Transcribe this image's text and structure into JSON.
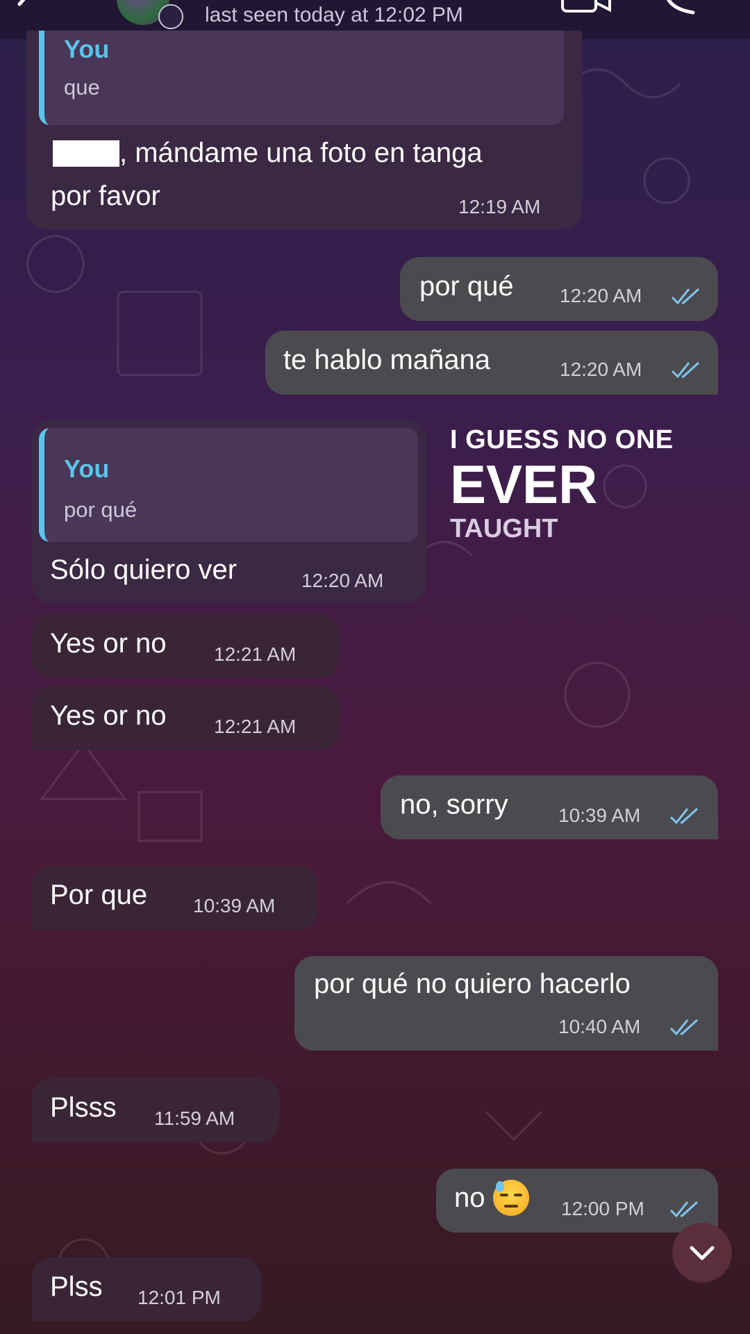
{
  "header": {
    "last_seen": "last seen today at 12:02 PM"
  },
  "messages": [
    {
      "reply_name": "You",
      "reply_text": "que",
      "text_line1": ", mándame una foto en tanga",
      "text_line2": "por favor",
      "time": "12:19 AM"
    },
    {
      "text": "por qué",
      "time": "12:20 AM"
    },
    {
      "text": "te hablo mañana",
      "time": "12:20 AM"
    },
    {
      "reply_name": "You",
      "reply_text": "por qué",
      "text": "Sólo quiero ver",
      "time": "12:20 AM"
    },
    {
      "text": "Yes or no",
      "time": "12:21 AM"
    },
    {
      "text": "Yes or no",
      "time": "12:21 AM"
    },
    {
      "text": "no, sorry",
      "time": "10:39 AM"
    },
    {
      "text": "Por que",
      "time": "10:39 AM"
    },
    {
      "text": "por qué no quiero hacerlo",
      "time": "10:40 AM"
    },
    {
      "text": "Plsss",
      "time": "11:59 AM"
    },
    {
      "text": "no",
      "emoji": "downcast-face-with-sweat",
      "time": "12:00 PM"
    },
    {
      "text": "Plss",
      "time": "12:01 PM"
    }
  ],
  "sticker": {
    "line1": "I GUESS NO ONE",
    "line2": "EVER",
    "line3": "TAUGHT"
  },
  "colors": {
    "incoming_bubble": "#3b2843",
    "outgoing_bubble": "#4b4b4f",
    "reply_accent": "#5bc4ea",
    "read_ticks": "#7fc6ee"
  },
  "icons": [
    "back-icon",
    "timer-icon",
    "video-call-icon",
    "phone-call-icon",
    "double-check-icon",
    "chevron-down-icon"
  ]
}
